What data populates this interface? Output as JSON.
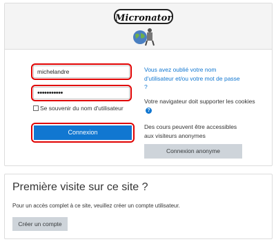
{
  "site": {
    "logo_text": "Micronator"
  },
  "login": {
    "username_value": "michelandre",
    "password_value": "•••••••••••",
    "remember_label": "Se souvenir du nom d'utilisateur",
    "login_button": "Connexion"
  },
  "help": {
    "forgot_link": "Vous avez oublié votre nom d'utilisateur et/ou votre mot de passe ?",
    "cookies_text": "Votre navigateur doit supporter les cookies",
    "help_icon": "?",
    "guest_text": "Des cours peuvent être accessibles aux visiteurs anonymes",
    "guest_button": "Connexion anonyme"
  },
  "first_visit": {
    "title": "Première visite sur ce site ?",
    "text": "Pour un accès complet à ce site, veuillez créer un compte utilisateur.",
    "create_button": "Créer un compte"
  }
}
